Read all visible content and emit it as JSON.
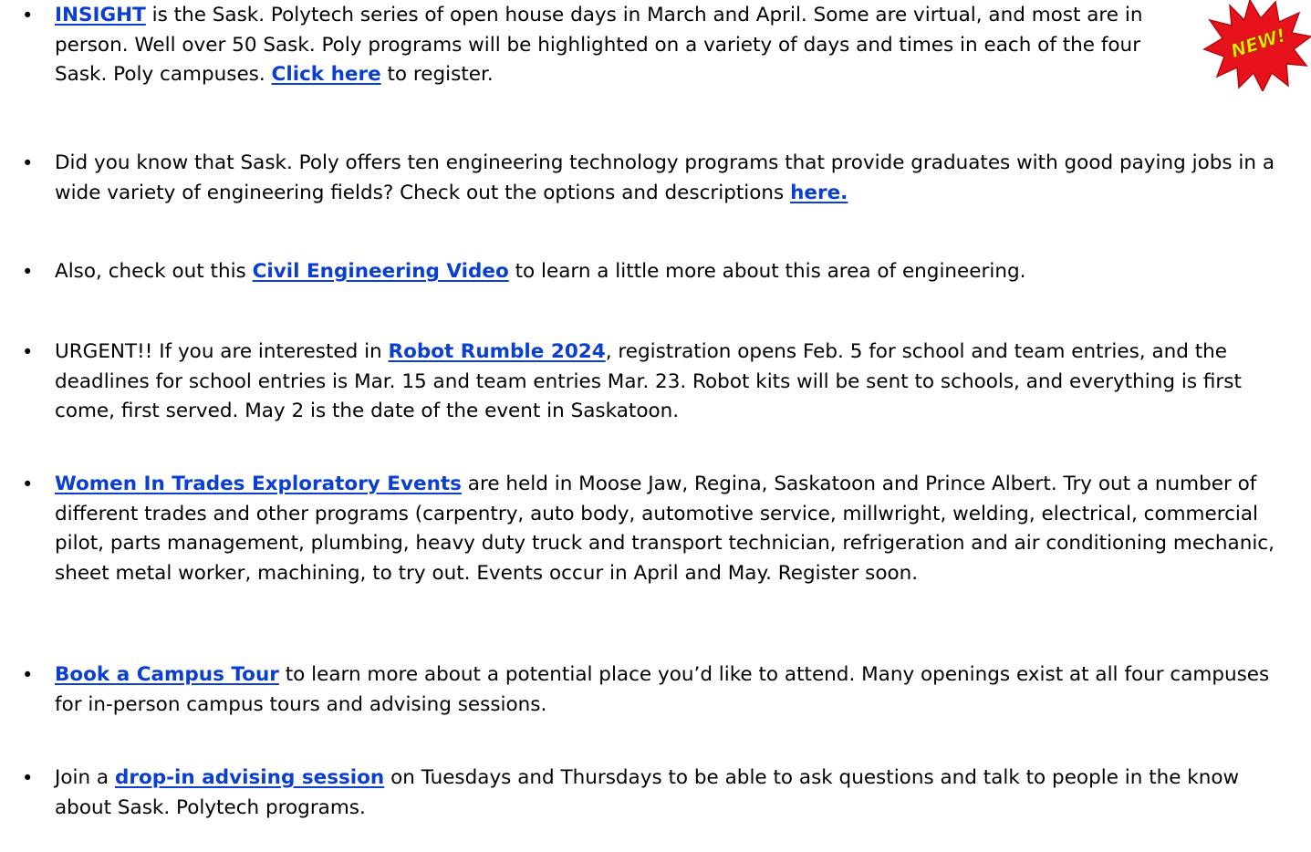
{
  "items": [
    {
      "link": "INSIGHT",
      "text": " is the Sask. Polytech series of open house days in March and April.  Some are virtual, and most are in person.  Well over 50 Sask. Poly programs will be highlighted on a variety of days and times in each of the four Sask. Poly campuses.  ",
      "link2": "Click here",
      "text2": " to register."
    },
    {
      "text": "Did you know that Sask. Poly offers ten engineering technology programs that provide graduates with good paying jobs in a wide variety of engineering fields?  Check out the options and descriptions ",
      "link": "here."
    },
    {
      "text": "Also, check out this ",
      "link": "Civil Engineering Video",
      "text2": " to learn a little more about this area of engineering."
    },
    {
      "text": "URGENT!!  If you are interested in ",
      "link": "Robot Rumble 2024",
      "text2": ", registration opens Feb. 5 for school and team entries, and the deadlines for school entries is Mar. 15 and team entries Mar. 23.  Robot kits will be sent to schools, and everything is first come, first served.  May 2 is the date of the event in Saskatoon."
    },
    {
      "link": "Women In Trades Exploratory Events",
      "text": " are held in Moose Jaw, Regina, Saskatoon and Prince Albert.  Try out a number of different trades and other programs (carpentry, auto body, automotive service, millwright, welding, electrical, commercial pilot, parts management, plumbing, heavy duty truck and transport technician, refrigeration and air conditioning mechanic, sheet metal worker, machining, to try out.  Events occur in April and May.  Register soon."
    },
    {
      "link": "Book a Campus Tour",
      "text": " to learn more about a potential place you’d like to attend.  Many openings exist at all four campuses for in-person campus tours and advising sessions."
    },
    {
      "text": "Join a ",
      "link": "drop-in advising session",
      "text2": " on Tuesdays and Thursdays to be able to ask questions and talk to people in the know about Sask. Polytech programs."
    }
  ],
  "badge": {
    "label": "NEW!",
    "fill": "#e8121c",
    "text_color": "#f7e400"
  },
  "colors": {
    "link": "#0b3fd1"
  }
}
